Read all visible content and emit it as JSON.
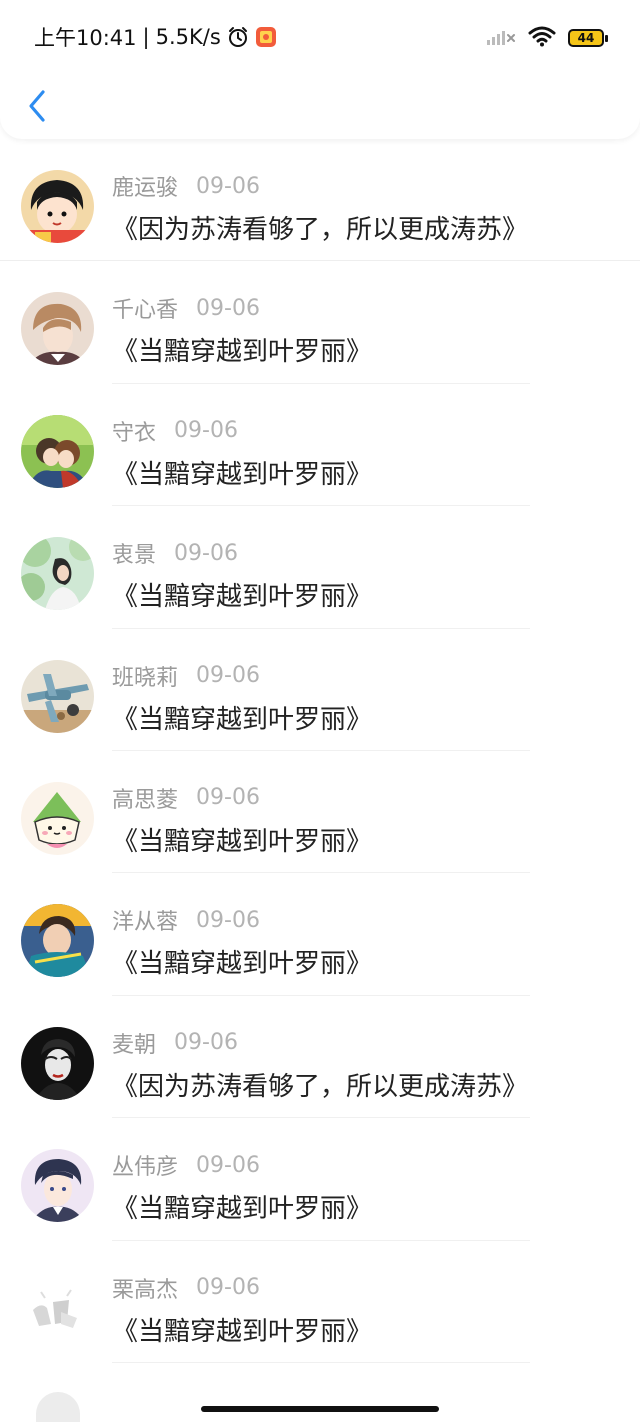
{
  "status_bar": {
    "time": "上午10:41",
    "separator": "|",
    "speed": "5.5K/s",
    "battery": "44"
  },
  "colors": {
    "accent": "#2d8cf0",
    "name_text": "#9a9a9a",
    "comment_text": "#222222"
  },
  "comments": [
    {
      "name": "鹿运骏",
      "date": "09-06",
      "text": "《因为苏涛看够了，所以更成涛苏》",
      "avatar": "cartoon-girl-avatar"
    },
    {
      "name": "千心香",
      "date": "09-06",
      "text": "《当黯穿越到叶罗丽》",
      "avatar": "anime-boy-avatar"
    },
    {
      "name": "守衣",
      "date": "09-06",
      "text": "《当黯穿越到叶罗丽》",
      "avatar": "anime-couple-avatar"
    },
    {
      "name": "衷景",
      "date": "09-06",
      "text": "《当黯穿越到叶罗丽》",
      "avatar": "girl-nature-avatar"
    },
    {
      "name": "班晓莉",
      "date": "09-06",
      "text": "《当黯穿越到叶罗丽》",
      "avatar": "toy-plane-avatar"
    },
    {
      "name": "高思菱",
      "date": "09-06",
      "text": "《当黯穿越到叶罗丽》",
      "avatar": "rice-dumpling-avatar"
    },
    {
      "name": "洋从蓉",
      "date": "09-06",
      "text": "《当黯穿越到叶罗丽》",
      "avatar": "boy-photo-avatar"
    },
    {
      "name": "麦朝",
      "date": "09-06",
      "text": "《因为苏涛看够了，所以更成涛苏》",
      "avatar": "dark-portrait-avatar"
    },
    {
      "name": "丛伟彦",
      "date": "09-06",
      "text": "《当黯穿越到叶罗丽》",
      "avatar": "anime-man-avatar"
    },
    {
      "name": "栗高杰",
      "date": "09-06",
      "text": "《当黯穿越到叶罗丽》",
      "avatar": "sketch-avatar"
    }
  ]
}
